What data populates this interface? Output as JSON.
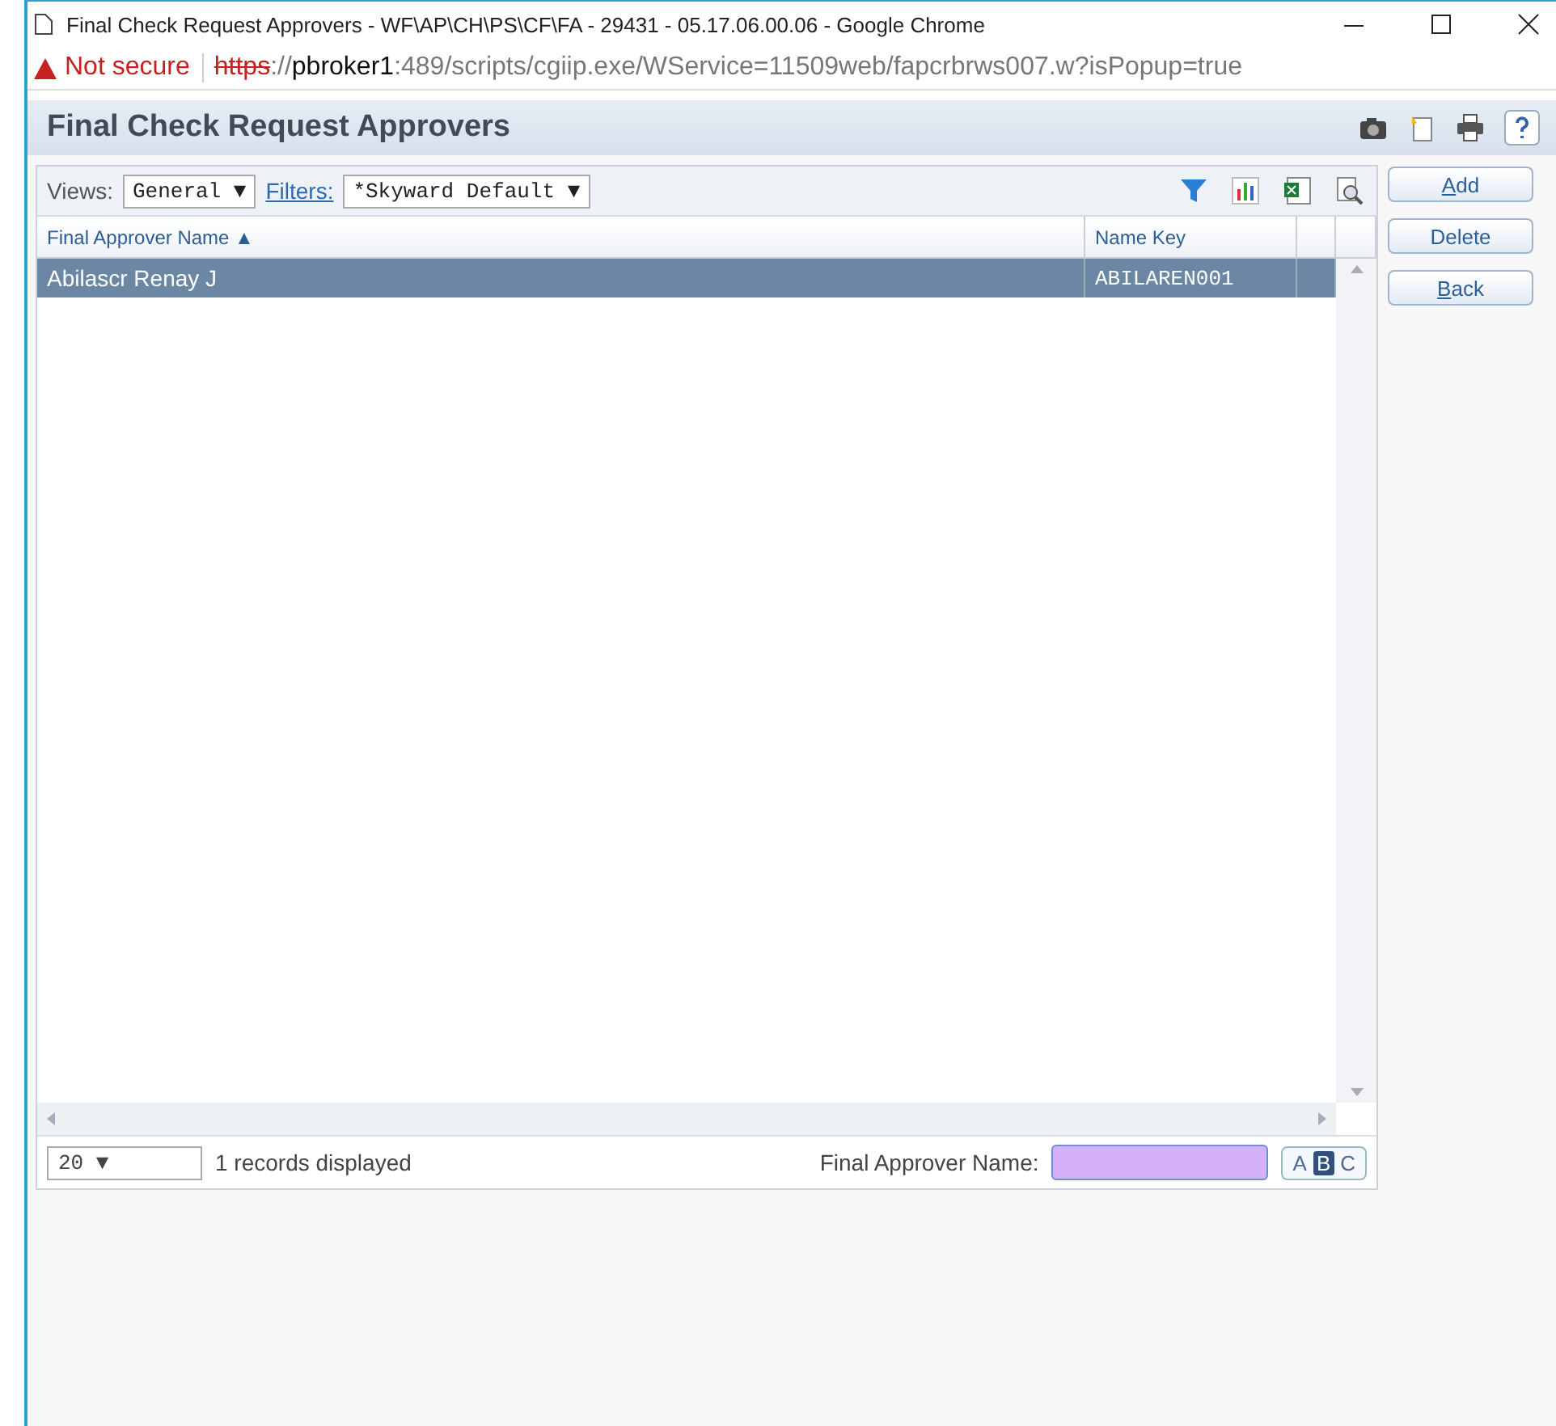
{
  "window": {
    "title": "Final Check Request Approvers - WF\\AP\\CH\\PS\\CF\\FA - 29431 - 05.17.06.00.06 - Google Chrome"
  },
  "address_bar": {
    "security": "Not secure",
    "scheme": "https",
    "separator": "://",
    "host": "pbroker1",
    "path": ":489/scripts/cgiip.exe/WService=11509web/fapcrbrws007.w?isPopup=true"
  },
  "page_title": "Final Check Request Approvers",
  "toolbar": {
    "views_label": "Views:",
    "views_value": "General ▼",
    "filters_label": "Filters:",
    "filters_value": "*Skyward Default ▼"
  },
  "buttons": [
    {
      "label": "Add",
      "access_key": true
    },
    {
      "label": "Delete",
      "access_key": false
    },
    {
      "label": "Back",
      "access_key": true
    }
  ],
  "table": {
    "columns": [
      {
        "label": "Final Approver Name ▲"
      },
      {
        "label": "Name Key"
      }
    ],
    "rows": [
      {
        "cells": [
          "Abilascr Renay J",
          "ABILAREN001"
        ],
        "selected": true
      }
    ]
  },
  "footer": {
    "page_size": "20 ▼",
    "records": "1 records displayed",
    "search_label": "Final Approver Name:",
    "letters": [
      {
        "label": "A",
        "selected": false
      },
      {
        "label": "B",
        "selected": true
      },
      {
        "label": "C",
        "selected": false
      }
    ]
  }
}
